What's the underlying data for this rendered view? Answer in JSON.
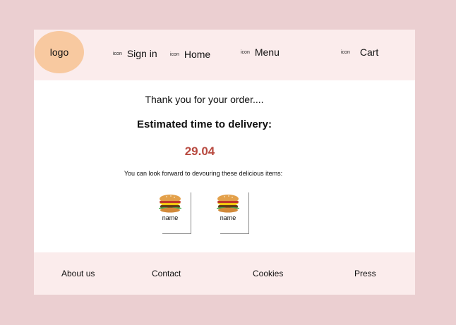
{
  "header": {
    "logo_text": "logo",
    "nav": [
      {
        "icon": "icon",
        "label": "Sign in"
      },
      {
        "icon": "icon",
        "label": "Home"
      },
      {
        "icon": "icon",
        "label": "Menu"
      },
      {
        "icon": "icon",
        "label": "Cart"
      }
    ]
  },
  "confirmation": {
    "thanks": "Thank you for your order....",
    "eta_title": "Estimated time to delivery:",
    "eta_value": "29.04",
    "forward_text": "You can look forward to devouring these delicious items:"
  },
  "items": [
    {
      "image": "burger-image",
      "name": "name"
    },
    {
      "image": "burger-image",
      "name": "name"
    }
  ],
  "footer": {
    "links": [
      "About us",
      "Contact",
      "Cookies",
      "Press"
    ]
  },
  "colors": {
    "page_background": "#ebcfd1",
    "header_footer_background": "#fbecec",
    "logo_background": "#f8c9a0",
    "eta_accent": "#b84a40"
  }
}
